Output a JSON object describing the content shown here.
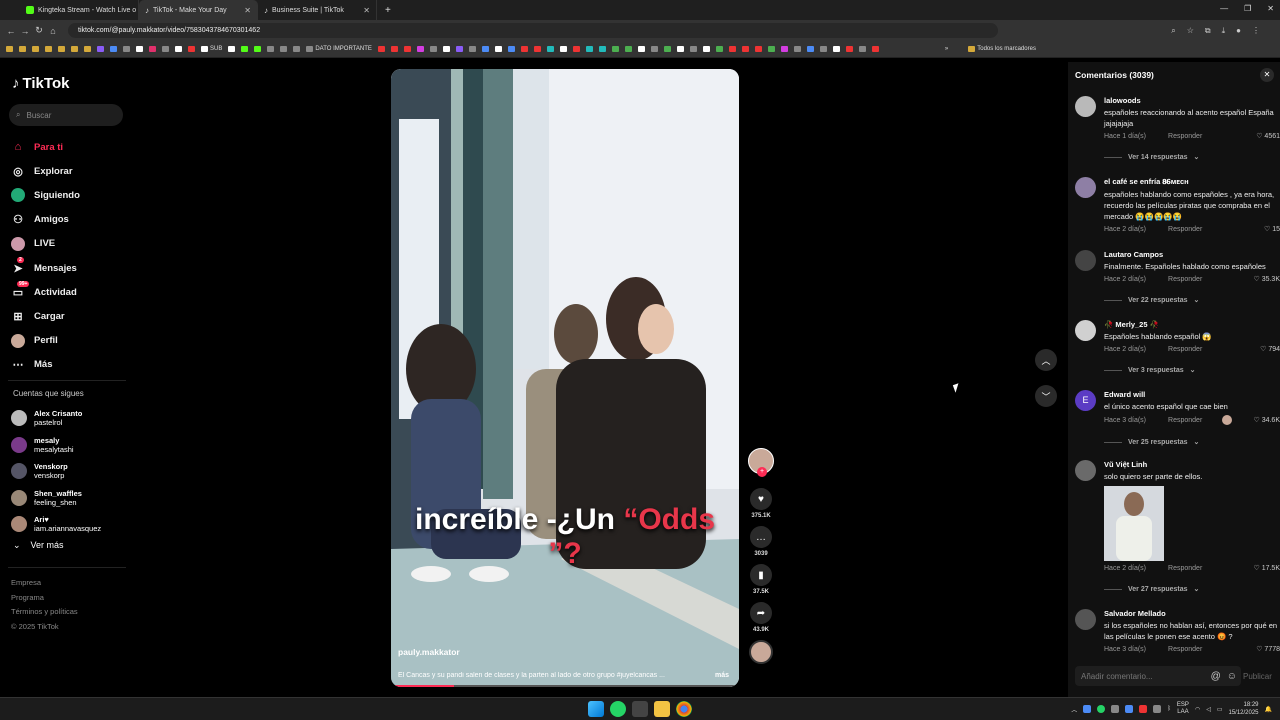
{
  "browser": {
    "tabs": [
      {
        "title": "Kingteka Stream - Watch Live o",
        "favicon_color": "#53fc18"
      },
      {
        "title": "TikTok - Make Your Day",
        "favicon_color": "#ffffff"
      },
      {
        "title": "Business Suite | TikTok",
        "favicon_color": "#ffffff"
      }
    ],
    "url": "tiktok.com/@pauly.makkator/video/7583043784670301462",
    "bookmarks": [
      "SUB",
      "DATO IMPORTANTE"
    ],
    "all_bookmarks_label": "Todos los marcadores"
  },
  "sidebar": {
    "logo": "TikTok",
    "search_placeholder": "Buscar",
    "nav": [
      {
        "label": "Para ti",
        "icon": "home-icon"
      },
      {
        "label": "Explorar",
        "icon": "compass-icon"
      },
      {
        "label": "Siguiendo",
        "icon": "following-icon"
      },
      {
        "label": "Amigos",
        "icon": "friends-icon"
      },
      {
        "label": "LIVE",
        "icon": "live-icon"
      },
      {
        "label": "Mensajes",
        "icon": "messages-icon",
        "badge": "2"
      },
      {
        "label": "Actividad",
        "icon": "activity-icon",
        "badge": "99+"
      },
      {
        "label": "Cargar",
        "icon": "upload-icon"
      },
      {
        "label": "Perfil",
        "icon": "profile-icon"
      },
      {
        "label": "Más",
        "icon": "more-icon"
      }
    ],
    "following_title": "Cuentas que sigues",
    "following": [
      {
        "name": "Alex Crisanto",
        "handle": "pastelrol"
      },
      {
        "name": "mesaly",
        "handle": "mesalytashi"
      },
      {
        "name": "Venskorp",
        "handle": "venskorp"
      },
      {
        "name": "Shen_waffles",
        "handle": "feeling_shen"
      },
      {
        "name": "Ari♥",
        "handle": "iam.ariannavasquez"
      }
    ],
    "see_more": "Ver más",
    "footer": [
      "Empresa",
      "Programa",
      "Términos y políticas",
      "© 2025 TikTok"
    ]
  },
  "video": {
    "caption_main": "increíble -¿Un ",
    "caption_highlight": "“Odds",
    "caption_end": "”?",
    "author": "pauly.makkator",
    "description": "El Cancas y su pandi salen de clases y la parten al lado de otro grupo #juyelcancas ...",
    "more": "más",
    "progress": 0.18
  },
  "actions": {
    "likes": "375.1K",
    "comments": "3039",
    "saves": "37.5K",
    "shares": "43.9K"
  },
  "comments": {
    "title": "Comentarios (3039)",
    "reply_label": "Responder",
    "items": [
      {
        "user": "lalowoods",
        "text": "españoles reaccionando al acento español España jajajajaja",
        "time": "Hace 1 día(s)",
        "likes": "4561",
        "replies": "Ver 14 respuestas",
        "avatar": "#b9b9b9"
      },
      {
        "user": "el café se enfría 𝟖𝟔ᴍᴇᴄʜ",
        "text": "españoles hablando como españoles , ya era hora, recuerdo las películas piratas que compraba en el mercado 😭😭😭😭😭",
        "time": "Hace 2 día(s)",
        "likes": "15",
        "replies": "",
        "avatar": "#8e7fa5"
      },
      {
        "user": "Lautaro Campos",
        "text": "Finalmente. Españoles hablado como españoles",
        "time": "Hace 2 día(s)",
        "likes": "35.3K",
        "replies": "Ver 22 respuestas",
        "avatar": "#444444"
      },
      {
        "user": "🥀 Merly_25 🥀",
        "text": "Españoles hablando español 😱",
        "time": "Hace 2 día(s)",
        "likes": "794",
        "replies": "Ver 3 respuestas",
        "avatar": "#d0d0d0"
      },
      {
        "user": "Edward will",
        "text": "el único acento español que cae bien",
        "time": "Hace 3 día(s)",
        "likes": "34.6K",
        "replies": "Ver 25 respuestas",
        "avatar": "#5b3cc4",
        "initial": "E"
      },
      {
        "user": "Vũ Việt Linh",
        "text": "solo quiero ser parte de ellos.",
        "time": "Hace 2 día(s)",
        "likes": "17.5K",
        "replies": "Ver 27 respuestas",
        "avatar": "#6a6a6a"
      },
      {
        "user": "Salvador Mellado",
        "text": "si los españoles no hablan así, entonces por qué en las películas le ponen ese acento 😡 ?",
        "time": "Hace 3 día(s)",
        "likes": "7778",
        "replies": "",
        "avatar": "#555555"
      }
    ],
    "input_placeholder": "Añadir comentario...",
    "publish": "Publicar"
  },
  "taskbar": {
    "lang": "ESP",
    "lang2": "LAA",
    "time": "18:29",
    "date": "15/12/2025"
  }
}
